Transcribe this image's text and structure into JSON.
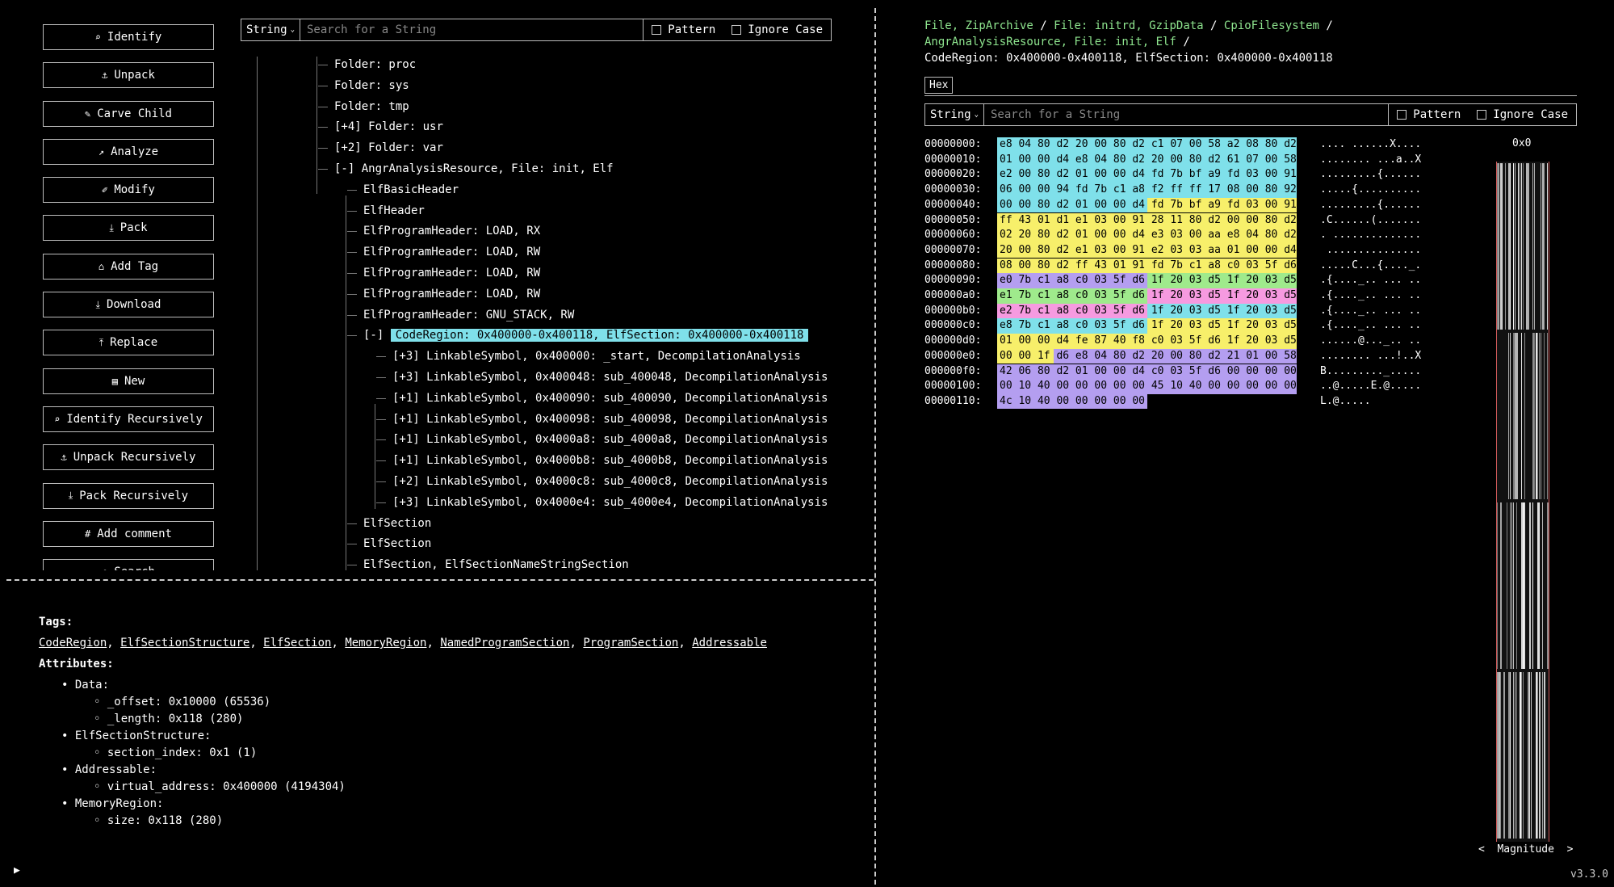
{
  "actions": [
    {
      "label": "Identify",
      "icon": "search-icon",
      "glyph": "⌕"
    },
    {
      "label": "Unpack",
      "icon": "anchor-icon",
      "glyph": "⚓"
    },
    {
      "label": "Carve Child",
      "icon": "pencil-icon",
      "glyph": "✎"
    },
    {
      "label": "Analyze",
      "icon": "trending-up-icon",
      "glyph": "↗"
    },
    {
      "label": "Modify",
      "icon": "edit-icon",
      "glyph": "✐"
    },
    {
      "label": "Pack",
      "icon": "download-icon",
      "glyph": "⤓"
    },
    {
      "label": "Add Tag",
      "icon": "tag-icon",
      "glyph": "⌂"
    },
    {
      "label": "Download",
      "icon": "download-icon",
      "glyph": "⤓"
    },
    {
      "label": "Replace",
      "icon": "upload-icon",
      "glyph": "⤒"
    },
    {
      "label": "New",
      "icon": "file-icon",
      "glyph": "▤"
    },
    {
      "label": "Identify Recursively",
      "icon": "search-icon",
      "glyph": "⌕"
    },
    {
      "label": "Unpack Recursively",
      "icon": "anchor-icon",
      "glyph": "⚓"
    },
    {
      "label": "Pack Recursively",
      "icon": "download-icon",
      "glyph": "⤓"
    },
    {
      "label": "Add comment",
      "icon": "hash-icon",
      "glyph": "#"
    },
    {
      "label": "Search",
      "icon": "search-icon",
      "glyph": "⌕"
    }
  ],
  "tree_search": {
    "type": "String",
    "placeholder": "Search for a String",
    "pattern": "Pattern",
    "ignore_case": "Ignore Case"
  },
  "tree": [
    {
      "text": "Folder: proc",
      "depth": 2,
      "prefix": ""
    },
    {
      "text": "Folder: sys",
      "depth": 2,
      "prefix": ""
    },
    {
      "text": "Folder: tmp",
      "depth": 2,
      "prefix": ""
    },
    {
      "text": "Folder: usr",
      "depth": 2,
      "prefix": "[+4]"
    },
    {
      "text": "Folder: var",
      "depth": 2,
      "prefix": "[+2]"
    },
    {
      "text": "AngrAnalysisResource, File: init, Elf",
      "depth": 2,
      "prefix": "[-]"
    },
    {
      "text": "ElfBasicHeader",
      "depth": 3,
      "prefix": ""
    },
    {
      "text": "ElfHeader",
      "depth": 3,
      "prefix": ""
    },
    {
      "text": "ElfProgramHeader: LOAD, RX",
      "depth": 3,
      "prefix": ""
    },
    {
      "text": "ElfProgramHeader: LOAD, RW",
      "depth": 3,
      "prefix": ""
    },
    {
      "text": "ElfProgramHeader: LOAD, RW",
      "depth": 3,
      "prefix": ""
    },
    {
      "text": "ElfProgramHeader: LOAD, RW",
      "depth": 3,
      "prefix": ""
    },
    {
      "text": "ElfProgramHeader: GNU_STACK, RW",
      "depth": 3,
      "prefix": ""
    },
    {
      "text": "CodeRegion: 0x400000-0x400118, ElfSection: 0x400000-0x400118",
      "depth": 3,
      "prefix": "[-]",
      "selected": true
    },
    {
      "text": "LinkableSymbol, 0x400000: _start, DecompilationAnalysis",
      "depth": 4,
      "prefix": "[+3]"
    },
    {
      "text": "LinkableSymbol, 0x400048: sub_400048, DecompilationAnalysis",
      "depth": 4,
      "prefix": "[+3]"
    },
    {
      "text": "LinkableSymbol, 0x400090: sub_400090, DecompilationAnalysis",
      "depth": 4,
      "prefix": "[+1]"
    },
    {
      "text": "LinkableSymbol, 0x400098: sub_400098, DecompilationAnalysis",
      "depth": 4,
      "prefix": "[+1]"
    },
    {
      "text": "LinkableSymbol, 0x4000a8: sub_4000a8, DecompilationAnalysis",
      "depth": 4,
      "prefix": "[+1]"
    },
    {
      "text": "LinkableSymbol, 0x4000b8: sub_4000b8, DecompilationAnalysis",
      "depth": 4,
      "prefix": "[+1]"
    },
    {
      "text": "LinkableSymbol, 0x4000c8: sub_4000c8, DecompilationAnalysis",
      "depth": 4,
      "prefix": "[+2]"
    },
    {
      "text": "LinkableSymbol, 0x4000e4: sub_4000e4, DecompilationAnalysis",
      "depth": 4,
      "prefix": "[+3]"
    },
    {
      "text": "ElfSection",
      "depth": 3,
      "prefix": ""
    },
    {
      "text": "ElfSection",
      "depth": 3,
      "prefix": ""
    },
    {
      "text": "ElfSection, ElfSectionNameStringSection",
      "depth": 3,
      "prefix": ""
    }
  ],
  "tags_heading": "Tags:",
  "tags": [
    "CodeRegion",
    "ElfSectionStructure",
    "ElfSection",
    "MemoryRegion",
    "NamedProgramSection",
    "ProgramSection",
    "Addressable"
  ],
  "attributes_heading": "Attributes:",
  "attributes": [
    {
      "name": "Data:",
      "items": [
        "_offset: 0x10000 (65536)",
        "_length: 0x118 (280)"
      ]
    },
    {
      "name": "ElfSectionStructure:",
      "items": [
        "section_index: 0x1 (1)"
      ]
    },
    {
      "name": "Addressable:",
      "items": [
        "virtual_address: 0x400000 (4194304)"
      ]
    },
    {
      "name": "MemoryRegion:",
      "items": [
        "size: 0x118 (280)"
      ]
    }
  ],
  "breadcrumb": {
    "parts": [
      "File, ZipArchive",
      "File: initrd, GzipData",
      "CpioFilesystem",
      "AngrAnalysisResource, File: init, Elf"
    ],
    "sep": "/",
    "current": "CodeRegion: 0x400000-0x400118, ElfSection: 0x400000-0x400118"
  },
  "hex_tab": "Hex",
  "hex_search": {
    "type": "String",
    "placeholder": "Search for a String",
    "pattern": "Pattern",
    "ignore_case": "Ignore Case"
  },
  "hex_colors": {
    "cyan": "#7fe0ea",
    "yellow": "#f7ef6a",
    "purple": "#b49ef0",
    "green": "#9fea8c",
    "pink": "#f69ae0"
  },
  "hex_rows": [
    {
      "offset": "00000000:",
      "bytes": "e8 04 80 d2 20 00 80 d2 c1 07 00 58 a2 08 80 d2",
      "ascii": ".... ......X....",
      "segments": [
        [
          "cyan",
          0,
          16
        ]
      ]
    },
    {
      "offset": "00000010:",
      "bytes": "01 00 00 d4 e8 04 80 d2 20 00 80 d2 61 07 00 58",
      "ascii": "........ ...a..X",
      "segments": [
        [
          "cyan",
          0,
          16
        ]
      ]
    },
    {
      "offset": "00000020:",
      "bytes": "e2 00 80 d2 01 00 00 d4 fd 7b bf a9 fd 03 00 91",
      "ascii": ".........{......",
      "segments": [
        [
          "cyan",
          0,
          16
        ]
      ]
    },
    {
      "offset": "00000030:",
      "bytes": "06 00 00 94 fd 7b c1 a8 f2 ff ff 17 08 00 80 92",
      "ascii": ".....{..........",
      "segments": [
        [
          "cyan",
          0,
          16
        ]
      ]
    },
    {
      "offset": "00000040:",
      "bytes": "00 00 80 d2 01 00 00 d4 fd 7b bf a9 fd 03 00 91",
      "ascii": ".........{......",
      "segments": [
        [
          "cyan",
          0,
          8
        ],
        [
          "yellow",
          8,
          16
        ]
      ]
    },
    {
      "offset": "00000050:",
      "bytes": "ff 43 01 d1 e1 03 00 91 28 11 80 d2 00 00 80 d2",
      "ascii": ".C......(.......",
      "segments": [
        [
          "yellow",
          0,
          16
        ]
      ]
    },
    {
      "offset": "00000060:",
      "bytes": "02 20 80 d2 01 00 00 d4 e3 03 00 aa e8 04 80 d2",
      "ascii": ". ..............",
      "segments": [
        [
          "yellow",
          0,
          16
        ]
      ]
    },
    {
      "offset": "00000070:",
      "bytes": "20 00 80 d2 e1 03 00 91 e2 03 03 aa 01 00 00 d4",
      "ascii": " ...............",
      "segments": [
        [
          "yellow",
          0,
          16
        ]
      ]
    },
    {
      "offset": "00000080:",
      "bytes": "08 00 80 d2 ff 43 01 91 fd 7b c1 a8 c0 03 5f d6",
      "ascii": ".....C...{...._.",
      "segments": [
        [
          "yellow",
          0,
          16
        ]
      ]
    },
    {
      "offset": "00000090:",
      "bytes": "e0 7b c1 a8 c0 03 5f d6 1f 20 03 d5 1f 20 03 d5",
      "ascii": ".{...._.. ... ..",
      "segments": [
        [
          "purple",
          0,
          8
        ],
        [
          "green",
          8,
          16
        ]
      ]
    },
    {
      "offset": "000000a0:",
      "bytes": "e1 7b c1 a8 c0 03 5f d6 1f 20 03 d5 1f 20 03 d5",
      "ascii": ".{...._.. ... ..",
      "segments": [
        [
          "green",
          0,
          8
        ],
        [
          "pink",
          8,
          16
        ]
      ]
    },
    {
      "offset": "000000b0:",
      "bytes": "e2 7b c1 a8 c0 03 5f d6 1f 20 03 d5 1f 20 03 d5",
      "ascii": ".{...._.. ... ..",
      "segments": [
        [
          "pink",
          0,
          8
        ],
        [
          "cyan",
          8,
          16
        ]
      ]
    },
    {
      "offset": "000000c0:",
      "bytes": "e8 7b c1 a8 c0 03 5f d6 1f 20 03 d5 1f 20 03 d5",
      "ascii": ".{...._.. ... ..",
      "segments": [
        [
          "cyan",
          0,
          8
        ],
        [
          "yellow",
          8,
          16
        ]
      ]
    },
    {
      "offset": "000000d0:",
      "bytes": "01 00 00 d4 fe 87 40 f8 c0 03 5f d6 1f 20 03 d5",
      "ascii": "......@..._.. ..",
      "segments": [
        [
          "yellow",
          0,
          16
        ]
      ]
    },
    {
      "offset": "000000e0:",
      "bytes": "00 00 1f d6 e8 04 80 d2 20 00 80 d2 21 01 00 58",
      "ascii": "........ ...!..X",
      "segments": [
        [
          "yellow",
          0,
          3
        ],
        [
          "purple",
          3,
          16
        ]
      ]
    },
    {
      "offset": "000000f0:",
      "bytes": "42 06 80 d2 01 00 00 d4 c0 03 5f d6 00 00 00 00",
      "ascii": "B........._.....",
      "segments": [
        [
          "purple",
          0,
          16
        ]
      ]
    },
    {
      "offset": "00000100:",
      "bytes": "00 10 40 00 00 00 00 00 45 10 40 00 00 00 00 00",
      "ascii": "..@.....E.@.....",
      "segments": [
        [
          "purple",
          0,
          16
        ]
      ]
    },
    {
      "offset": "00000110:",
      "bytes": "4c 10 40 00 00 00 00 00",
      "ascii": "L.@.....",
      "segments": [
        [
          "purple",
          0,
          8
        ]
      ]
    }
  ],
  "magnitude": {
    "offset_label": "0x0",
    "label": "Magnitude",
    "prev": "<",
    "next": ">"
  },
  "play_icon": "▶",
  "version": "v3.3.0"
}
